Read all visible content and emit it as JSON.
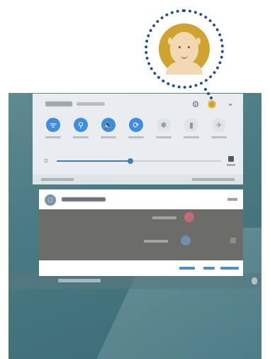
{
  "toggles": [
    {
      "name": "wifi",
      "icon": "wifi-icon",
      "glyph": "ᯤ",
      "on": true
    },
    {
      "name": "location",
      "icon": "location-icon",
      "glyph": "⚲",
      "on": true
    },
    {
      "name": "sound",
      "icon": "sound-icon",
      "glyph": "🔈",
      "on": true
    },
    {
      "name": "auto-rotate",
      "icon": "rotate-icon",
      "glyph": "⟳",
      "on": true
    },
    {
      "name": "bluetooth",
      "icon": "bluetooth-icon",
      "glyph": "✱",
      "on": false
    },
    {
      "name": "power-saving",
      "icon": "battery-icon",
      "glyph": "▮",
      "on": false
    },
    {
      "name": "airplane",
      "icon": "airplane-icon",
      "glyph": "✈",
      "on": false
    }
  ],
  "brightness": {
    "level_fraction": 0.45
  },
  "header": {
    "settings_glyph": "⚙",
    "chevron_glyph": "⌄"
  },
  "colors": {
    "accent": "#3d8ee0",
    "callout": "#1f4f8c",
    "avatar_bg": "#d0a22e"
  }
}
